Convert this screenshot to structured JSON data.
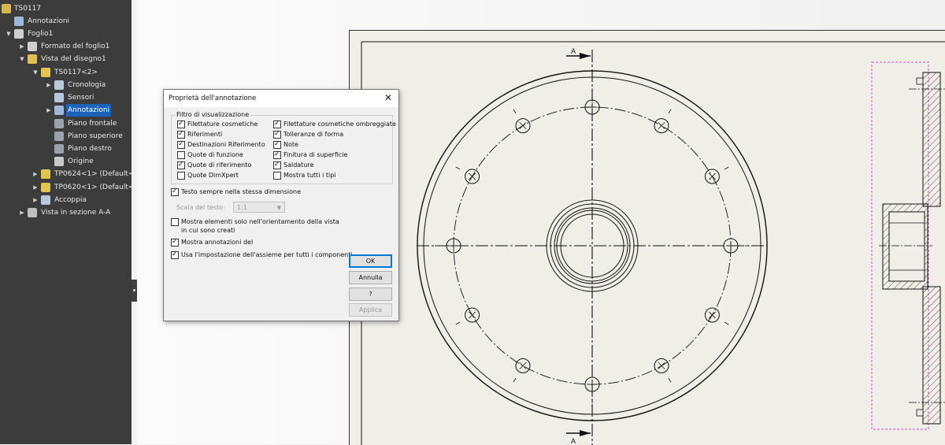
{
  "tree": {
    "items": [
      {
        "label": "TS0117",
        "icon": "drawing-doc-icon",
        "arrow": "",
        "selected": false
      },
      {
        "label": "Annotazioni",
        "icon": "annotation-icon",
        "arrow": "",
        "selected": false
      },
      {
        "label": "Foglio1",
        "icon": "sheet-icon",
        "arrow": "▼",
        "selected": false
      },
      {
        "label": "Formato del foglio1",
        "icon": "sheet-format-icon",
        "arrow": "▶",
        "selected": false
      },
      {
        "label": "Vista del disegno1",
        "icon": "drawing-view-icon",
        "arrow": "▼",
        "selected": false
      },
      {
        "label": "TS0117<2>",
        "icon": "assembly-icon",
        "arrow": "▼",
        "selected": false
      },
      {
        "label": "Cronologia",
        "icon": "history-icon",
        "arrow": "▶",
        "selected": false
      },
      {
        "label": "Sensori",
        "icon": "sensor-icon",
        "arrow": "",
        "selected": false
      },
      {
        "label": "Annotazioni",
        "icon": "annotation-icon",
        "arrow": "▶",
        "selected": true
      },
      {
        "label": "Piano frontale",
        "icon": "plane-icon",
        "arrow": "",
        "selected": false
      },
      {
        "label": "Piano superiore",
        "icon": "plane-icon",
        "arrow": "",
        "selected": false
      },
      {
        "label": "Piano destro",
        "icon": "plane-icon",
        "arrow": "",
        "selected": false
      },
      {
        "label": "Origine",
        "icon": "origin-icon",
        "arrow": "",
        "selected": false
      },
      {
        "label": "TP0624<1> (Default<",
        "icon": "part-icon",
        "arrow": "▶",
        "selected": false
      },
      {
        "label": "TP0620<1> (Default<",
        "icon": "part-icon",
        "arrow": "▶",
        "selected": false
      },
      {
        "label": "Accoppia",
        "icon": "mates-icon",
        "arrow": "▶",
        "selected": false
      },
      {
        "label": "Vista in sezione A-A",
        "icon": "section-view-icon",
        "arrow": "▶",
        "selected": false
      }
    ]
  },
  "dialog": {
    "title": "Proprietà dell'annotazione",
    "filter_legend": "Filtro di visualizzazione",
    "filter_left": [
      {
        "label": "Filettature cosmetiche",
        "checked": true
      },
      {
        "label": "Riferimenti",
        "checked": true
      },
      {
        "label": "Destinazioni Riferimento",
        "checked": true
      },
      {
        "label": "Quote di funzione",
        "checked": false
      },
      {
        "label": "Quote di riferimento",
        "checked": true
      },
      {
        "label": "Quote DimXpert",
        "checked": false
      }
    ],
    "filter_right": [
      {
        "label": "Filettature cosmetiche ombreggiate",
        "checked": true
      },
      {
        "label": "Tolleranze di forma",
        "checked": true
      },
      {
        "label": "Note",
        "checked": true
      },
      {
        "label": "Finitura di superficie",
        "checked": true
      },
      {
        "label": "Saldature",
        "checked": true
      },
      {
        "label": "Mostra tutti i tipi",
        "checked": false
      }
    ],
    "same_size": {
      "label": "Testo sempre nella stessa dimensione",
      "checked": true
    },
    "scale_label": "Scala del testo:",
    "scale_value": "1:1",
    "show_orientation": {
      "line1": "Mostra elementi solo nell'orientamento della vista",
      "line2": "in cui sono creati",
      "checked": false
    },
    "show_annotations": {
      "label": "Mostra annotazioni del",
      "checked": true
    },
    "use_assembly": {
      "label": "Usa l'impostazione dell'assieme per tutti i componenti",
      "checked": true
    },
    "buttons": {
      "ok": "OK",
      "cancel": "Annulla",
      "help": "?",
      "apply": "Applica"
    },
    "close_glyph": "✕"
  },
  "drawing": {
    "section_label_top": "A",
    "section_label_bottom": "A",
    "line_color": "#111111",
    "bbox_color": "#d24fd2"
  }
}
